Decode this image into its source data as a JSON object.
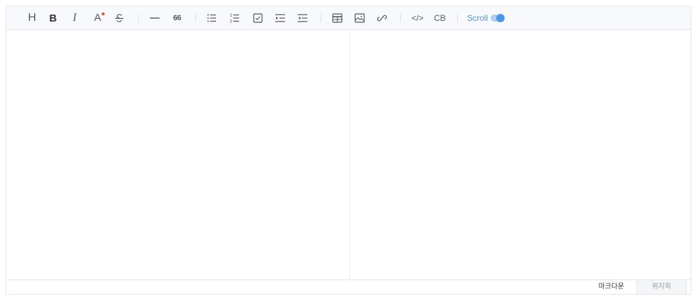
{
  "toolbar": {
    "heading_label": "H",
    "bold_label": "B",
    "italic_label": "I",
    "color_label": "A",
    "quote_label": "66",
    "code_label": "</>",
    "codeblock_label": "CB",
    "scroll_label": "Scroll",
    "scroll_sync_enabled": true,
    "color_dot_color": "#e0443a",
    "accent_color": "#4b96e6"
  },
  "editor": {
    "markdown_content": "",
    "preview_content": ""
  },
  "mode_tabs": {
    "markdown": "마크다운",
    "wysiwyg": "위지윅",
    "active": "markdown"
  }
}
